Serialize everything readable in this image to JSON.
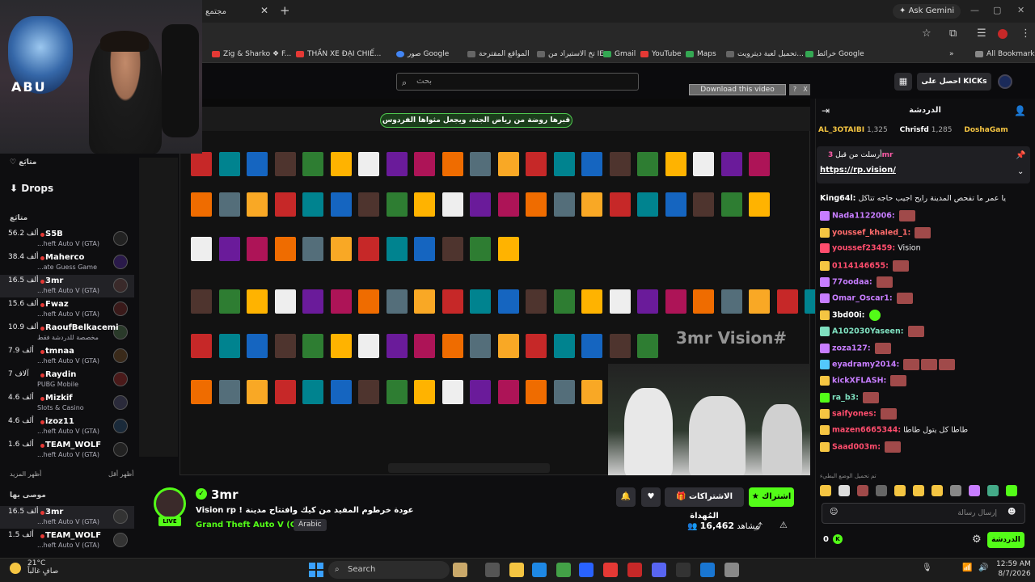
{
  "browser": {
    "tab_title": "مجتمع",
    "gemini": "Ask Gemini",
    "bookmarks": [
      "Zig & Sharko ❖ F...",
      "THẦN XE ĐẠI CHIẾ...",
      "صور Google",
      "المواقع المقترحة",
      "تخ الاستيراد من IE",
      "Gmail",
      "YouTube",
      "Maps",
      "تحميل لعبة ديترويت...",
      "خرائط Google"
    ],
    "all_bookmarks": "All Bookmarks"
  },
  "header": {
    "search_placeholder": "بحث",
    "get_kicks": "احصل على KICKs"
  },
  "video": {
    "download_label": "Download this video",
    "download_q": "?",
    "download_x": "X",
    "banner": "قبرها روضة من رياض الجنة، ويجعل مثواها الفردوس",
    "webcam_text": "ABU",
    "watermark": "3mr Vision#"
  },
  "sidebar": {
    "follow_title": "متابَع",
    "drops": "Drops",
    "following_title": "متابَع",
    "following": [
      {
        "name": "S5B",
        "game": "...heft Auto V (GTA)",
        "viewers": "56.2 ألف"
      },
      {
        "name": "Maherco",
        "game": "...ate Guess Game",
        "viewers": "38.4 ألف"
      },
      {
        "name": "3mr",
        "game": "...heft Auto V (GTA)",
        "viewers": "16.5 ألف"
      },
      {
        "name": "Fwaz",
        "game": "...heft Auto V (GTA)",
        "viewers": "15.6 ألف"
      },
      {
        "name": "RaoufBelkacemi",
        "game": "مخصصة للدردشة فقط",
        "viewers": "10.9 ألف"
      },
      {
        "name": "tmnaa",
        "game": "...heft Auto V (GTA)",
        "viewers": "7.9 ألف"
      },
      {
        "name": "Raydin",
        "game": "PUBG Mobile",
        "viewers": "7 آلاف"
      },
      {
        "name": "Mizkif",
        "game": "Slots & Casino",
        "viewers": "4.6 ألف"
      },
      {
        "name": "izoz11",
        "game": "...heft Auto V (GTA)",
        "viewers": "4.6 ألف"
      },
      {
        "name": "TEAM_WOLF",
        "game": "...heft Auto V (GTA)",
        "viewers": "1.6 ألف"
      }
    ],
    "show_more": "أظهر المزيد",
    "show_less": "أظهر أقل",
    "recommended_title": "موصى بها",
    "recommended": [
      {
        "name": "3mr",
        "game": "...heft Auto V (GTA)",
        "viewers": "16.5 ألف"
      },
      {
        "name": "TEAM_WOLF",
        "game": "...heft Auto V (GTA)",
        "viewers": "1.5 ألف"
      }
    ]
  },
  "stream": {
    "name": "3mr",
    "live": "LIVE",
    "title": "Vision rp ! عودة خرطوم المفيد من كيك وافتتاح مدينة",
    "game": "Grand Theft Auto V (GTA)",
    "language": "Arabic",
    "follow": "اشتراك",
    "gift_subs": "الاشتراكات المُهداة",
    "viewers_label": "مشاهد",
    "viewers": "16,462"
  },
  "chat": {
    "title": "الدردشة",
    "gifters": [
      {
        "name": "AL_3OTAIBI",
        "count": "1,325"
      },
      {
        "name": "Chrisfd",
        "count": "1,285"
      },
      {
        "name": "DoshaGam",
        "count": ""
      }
    ],
    "pinned_by": "أرسلت من قبل",
    "pinned_user": "3mr",
    "pinned_url": "https://rp.vision/",
    "messages": [
      {
        "user": "King64l:",
        "text": "يا عمر ما تفحص المدينة رايح اجيب حاجه تتاكل",
        "color": "#ffffff"
      },
      {
        "user": "Nada1122006:",
        "text": "",
        "color": "#c77dff"
      },
      {
        "user": "youssef_khaled_1:",
        "text": "",
        "color": "#ff6b6b"
      },
      {
        "user": "youssef23459:",
        "text": "Vision",
        "color": "#ff4d6d"
      },
      {
        "user": "0114146655:",
        "text": "",
        "color": "#ff4d6d"
      },
      {
        "user": "77oodaa:",
        "text": "",
        "color": "#c77dff"
      },
      {
        "user": "Omar_Oscar1:",
        "text": "",
        "color": "#c77dff"
      },
      {
        "user": "3bd00i:",
        "text": "",
        "color": "#ffffff"
      },
      {
        "user": "A102030Yaseen:",
        "text": "",
        "color": "#7fe0c0"
      },
      {
        "user": "zoza127:",
        "text": "",
        "color": "#c77dff"
      },
      {
        "user": "eyadramy2014:",
        "text": "",
        "color": "#c77dff"
      },
      {
        "user": "kickXFLASH:",
        "text": "",
        "color": "#c77dff"
      },
      {
        "user": "ra_b3:",
        "text": "",
        "color": "#7fe0c0"
      },
      {
        "user": "saifyones:",
        "text": "",
        "color": "#ff4d6d"
      },
      {
        "user": "mazen6665344:",
        "text": "طاطا كل يتول طاطا",
        "color": "#ff4d6d"
      },
      {
        "user": "Saad003m:",
        "text": "",
        "color": "#ff4d6d"
      }
    ],
    "loading_emotes": "تم تحميل الوضع البطيء",
    "input_placeholder": "إرسال رسالة",
    "kick_count": "0",
    "send": "الدردشة"
  },
  "taskbar": {
    "temp": "21°C",
    "weather": "صافٍ غالباً",
    "search": "Search",
    "time": "12:59 AM",
    "date": "8/7/2026"
  },
  "colors": {
    "accent": "#53fc18",
    "bg": "#0e0e10"
  }
}
